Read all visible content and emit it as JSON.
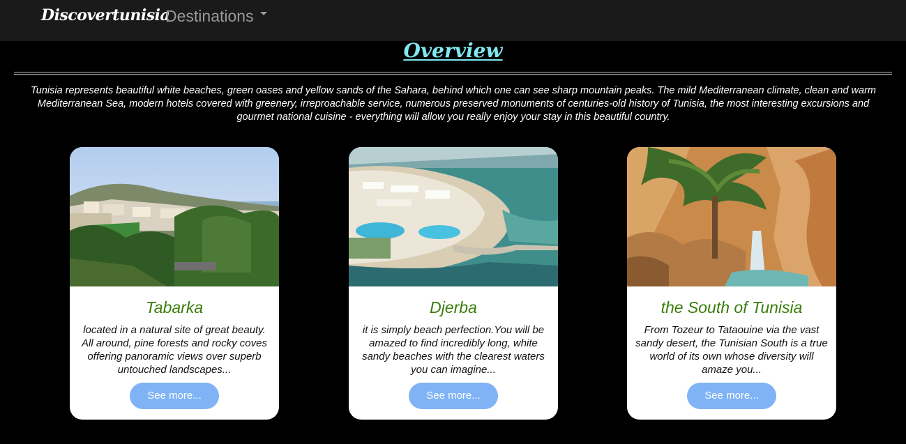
{
  "navbar": {
    "brand": "Discovertunisia",
    "destinations_label": "Destinations"
  },
  "overview": {
    "title": "Overview",
    "text": "Tunisia represents beautiful white beaches, green oases and yellow sands of the Sahara, behind which one can see sharp mountain peaks. The mild Mediterranean climate, clean and warm Mediterranean Sea, modern hotels covered with greenery, irreproachable service, numerous preserved monuments of centuries-old history of Tunisia, the most interesting excursions and gourmet national cuisine - everything will allow you really enjoy your stay in this beautiful country."
  },
  "cards": [
    {
      "title": "Tabarka",
      "text": "located in a natural site of great beauty. All around, pine forests and rocky coves offering panoramic views over superb untouched landscapes...",
      "button": "See more..."
    },
    {
      "title": "Djerba",
      "text": "it is simply beach perfection.You will be amazed to find incredibly long, white sandy beaches with the clearest waters you can imagine...",
      "button": "See more..."
    },
    {
      "title": "the South of Tunisia",
      "text": "From Tozeur to Tataouine via the vast sandy desert, the Tunisian South is a true world of its own whose diversity will amaze you...",
      "button": "See more..."
    }
  ],
  "colors": {
    "page_bg": "#000000",
    "navbar_bg": "#1a1a1a",
    "overview_title": "#7fe8f0",
    "card_title": "#3a7d0a",
    "button_bg": "#7fb3f6"
  }
}
